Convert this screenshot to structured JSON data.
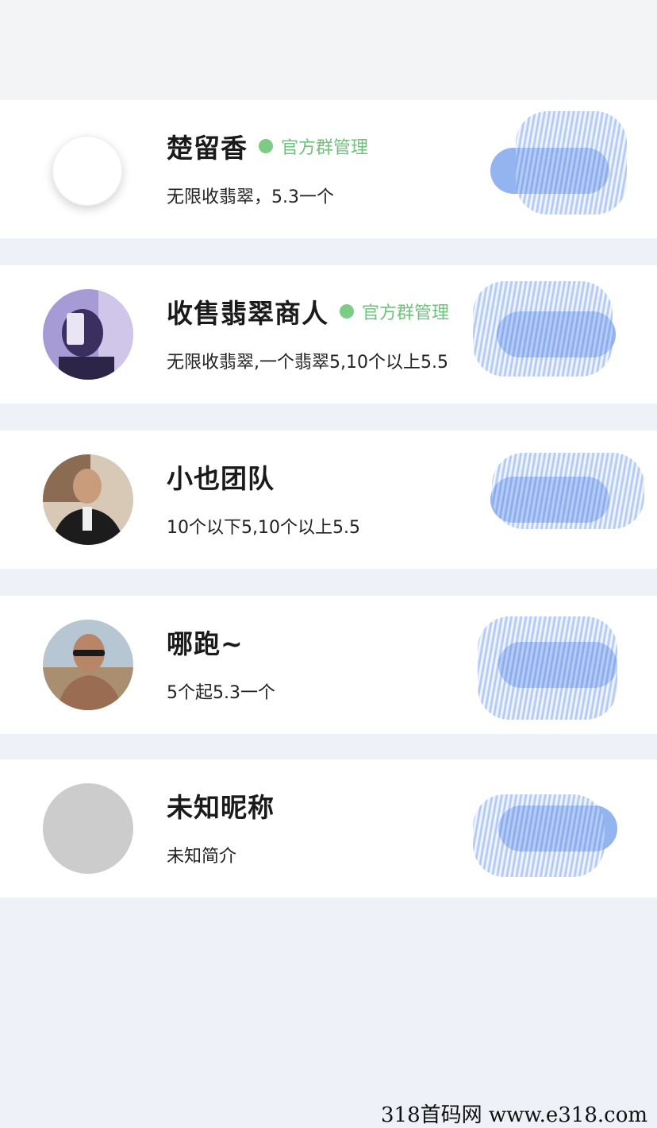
{
  "contacts": [
    {
      "name": "楚留香",
      "badge": "官方群管理",
      "description": "无限收翡翠，5.3一个",
      "avatar": "blank-white"
    },
    {
      "name": "收售翡翠商人",
      "badge": "官方群管理",
      "description": "无限收翡翠,一个翡翠5,10个以上5.5",
      "avatar": "photo-selfie-purple"
    },
    {
      "name": "小也团队",
      "badge": "",
      "description": "10个以下5,10个以上5.5",
      "avatar": "photo-man-suit"
    },
    {
      "name": "哪跑~",
      "badge": "",
      "description": "5个起5.3一个",
      "avatar": "photo-man-sunglasses"
    },
    {
      "name": "未知昵称",
      "badge": "",
      "description": "未知简介",
      "avatar": "placeholder-gray"
    }
  ],
  "badge_color": "#7ccc87",
  "button_color": "#93b4ef",
  "watermark": "318首码网 www.e318.com"
}
